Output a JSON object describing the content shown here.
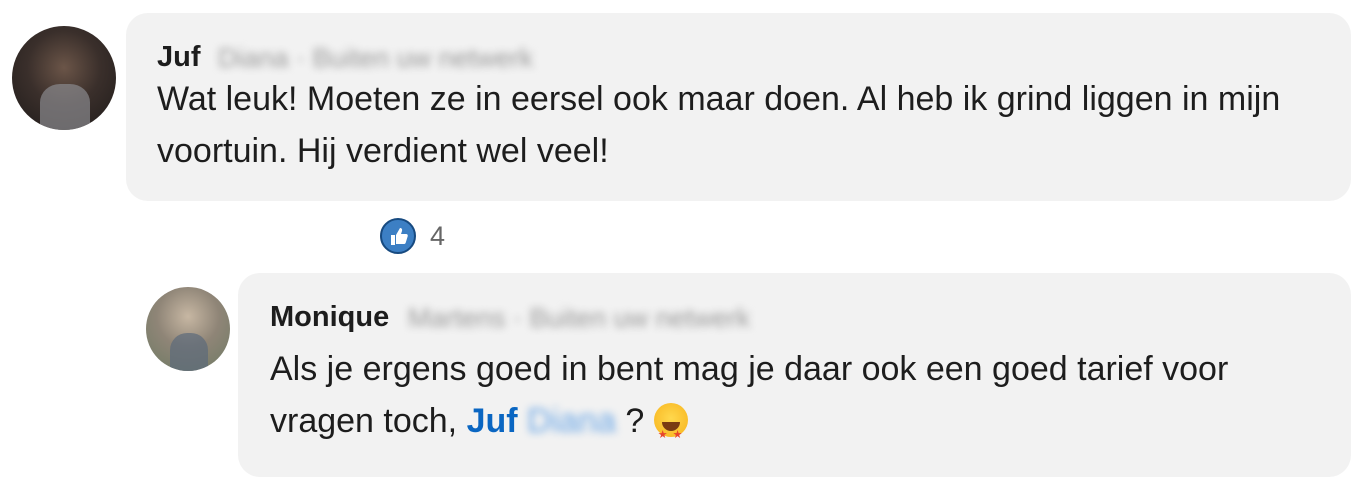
{
  "comments": [
    {
      "author_first": "Juf",
      "author_rest_blurred": "Diana · Buiten uw netwerk",
      "text": "Wat leuk! Moeten ze in eersel ook maar doen. Al heb ik grind liggen in mijn voortuin. Hij verdient wel veel!",
      "reactions": {
        "icon": "like-icon",
        "count": "4"
      }
    },
    {
      "author_first": "Monique",
      "author_rest_blurred": "Martens · Buiten uw netwerk",
      "text": "Als je ergens goed in bent mag je daar ook een goed tarief voor vragen toch,",
      "mention": "Juf",
      "mention_blurred": "Diana",
      "suffix": "?",
      "emoji": "star-struck-emoji-icon"
    }
  ],
  "colors": {
    "bubble": "#f2f2f2",
    "mention": "#0a66c2",
    "like": "#3c7fc4"
  }
}
